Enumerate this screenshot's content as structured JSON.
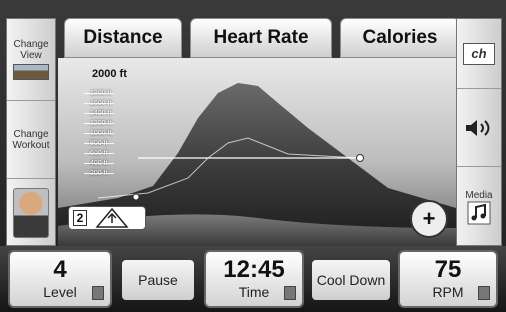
{
  "tabs": {
    "distance": "Distance",
    "heart_rate": "Heart Rate",
    "calories": "Calories"
  },
  "left_panel": {
    "change_view": "Change View",
    "change_workout": "Change Workout"
  },
  "right_panel": {
    "channel_label": "ch",
    "media": "Media"
  },
  "scene": {
    "elevation_header": "2000 ft",
    "elevation_ticks": [
      "1800 ft",
      "1600 ft",
      "1400 ft",
      "1200 ft",
      "1000 ft",
      "800 ft",
      "600 ft",
      "400 ft",
      "200 ft"
    ],
    "workout_level": "2"
  },
  "bottom": {
    "level_value": "4",
    "level_label": "Level",
    "pause": "Pause",
    "time_value": "12:45",
    "time_label": "Time",
    "cool_down": "Cool Down",
    "rpm_value": "75",
    "rpm_label": "RPM"
  }
}
